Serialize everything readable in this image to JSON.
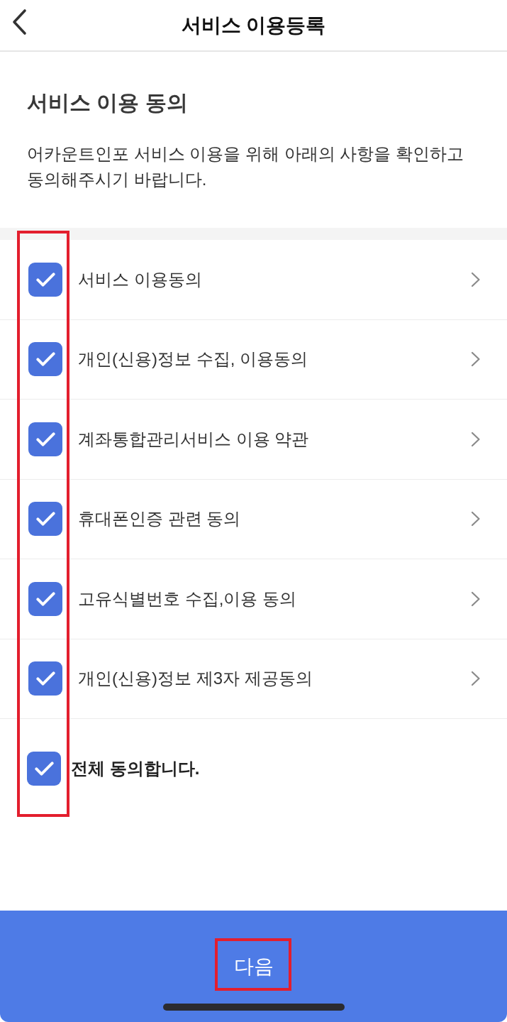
{
  "header": {
    "title": "서비스 이용등록"
  },
  "intro": {
    "heading": "서비스 이용 동의",
    "description": "어카운트인포 서비스 이용을 위해 아래의 사항을 확인하고 동의해주시기 바랍니다."
  },
  "agreements": [
    {
      "label": "서비스 이용동의",
      "checked": true
    },
    {
      "label": "개인(신용)정보 수집, 이용동의",
      "checked": true
    },
    {
      "label": "계좌통합관리서비스 이용 약관",
      "checked": true
    },
    {
      "label": "휴대폰인증 관련 동의",
      "checked": true
    },
    {
      "label": "고유식별번호 수집,이용 동의",
      "checked": true
    },
    {
      "label": "개인(신용)정보 제3자 제공동의",
      "checked": true
    }
  ],
  "agree_all": {
    "label": "전체 동의합니다.",
    "checked": true
  },
  "next_button": {
    "label": "다음"
  },
  "annotations": {
    "checkbox_column": true,
    "next_button": true
  }
}
